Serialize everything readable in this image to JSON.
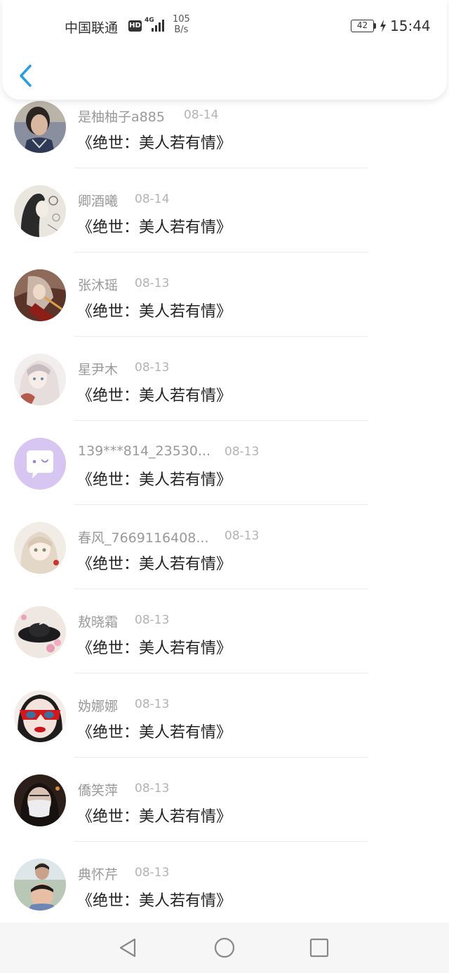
{
  "status_bar": {
    "carrier": "中国联通",
    "hd": "HD",
    "network": "4G",
    "net_speed_value": "105",
    "net_speed_unit": "B/s",
    "battery": "42",
    "time": "15:44"
  },
  "header": {
    "back_icon": "chevron-left-icon",
    "accent_color": "#2a9bdc"
  },
  "list": {
    "items": [
      {
        "name": "是柚柚子a885",
        "date": "08-14",
        "title": "《绝世：美人若有情》",
        "avatar": "photo-portrait"
      },
      {
        "name": "卿酒曦",
        "date": "08-14",
        "title": "《绝世：美人若有情》",
        "avatar": "sketch-girl"
      },
      {
        "name": "张沐瑶",
        "date": "08-13",
        "title": "《绝世：美人若有情》",
        "avatar": "anime-warrior"
      },
      {
        "name": "星尹木",
        "date": "08-13",
        "title": "《绝世：美人若有情》",
        "avatar": "anime-girl-light"
      },
      {
        "name": "139***814_23530...",
        "date": "08-13",
        "title": "《绝世：美人若有情》",
        "avatar": "default-chat-bubble"
      },
      {
        "name": "春风_7669116408...",
        "date": "08-13",
        "title": "《绝世：美人若有情》",
        "avatar": "anime-girl-doll"
      },
      {
        "name": "敖晓霜",
        "date": "08-13",
        "title": "《绝世：美人若有情》",
        "avatar": "hat-flowers"
      },
      {
        "name": "妫娜娜",
        "date": "08-13",
        "title": "《绝世：美人若有情》",
        "avatar": "red-sunglasses"
      },
      {
        "name": "僑笑萍",
        "date": "08-13",
        "title": "《绝世：美人若有情》",
        "avatar": "masked-selfie"
      },
      {
        "name": "典怀芹",
        "date": "08-13",
        "title": "《绝世：美人若有情》",
        "avatar": "kids-photo"
      }
    ]
  },
  "nav_bar": {
    "back_icon": "triangle-back-icon",
    "home_icon": "circle-home-icon",
    "recents_icon": "square-recents-icon"
  }
}
